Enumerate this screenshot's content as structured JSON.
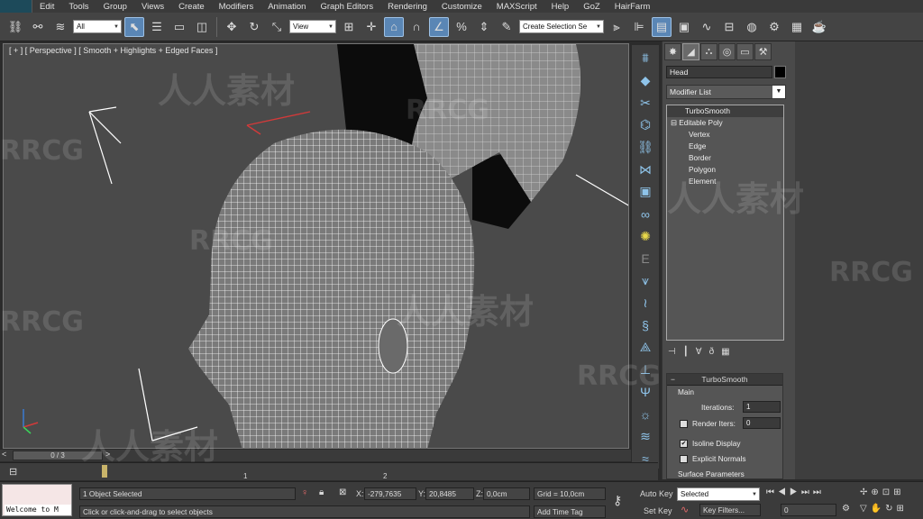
{
  "menu": [
    "Edit",
    "Tools",
    "Group",
    "Views",
    "Create",
    "Modifiers",
    "Animation",
    "Graph Editors",
    "Rendering",
    "Customize",
    "MAXScript",
    "Help",
    "GoZ",
    "HairFarm"
  ],
  "toolbar": {
    "filter_value": "All",
    "refcoord_value": "View",
    "selection_set_placeholder": "Create Selection Se"
  },
  "viewport": {
    "label": "[ + ] [ Perspective ] [ Smooth + Highlights + Edged Faces ]"
  },
  "panel": {
    "object_name": "Head",
    "object_color": "#000000",
    "modifier_list_label": "Modifier List",
    "stack": {
      "turbosmooth": "TurboSmooth",
      "editable_poly": "Editable Poly",
      "subobjects": [
        "Vertex",
        "Edge",
        "Border",
        "Polygon",
        "Element"
      ]
    },
    "turbosmooth_rollout": {
      "title": "TurboSmooth",
      "group_main": "Main",
      "iterations_label": "Iterations:",
      "iterations_value": "1",
      "render_iters_label": "Render Iters:",
      "render_iters_value": "0",
      "isoline_label": "Isoline Display",
      "isoline_checked": true,
      "explicit_normals_label": "Explicit Normals",
      "explicit_normals_checked": false,
      "surface_params_label": "Surface Parameters"
    }
  },
  "timeline": {
    "frame_range": "0 / 3",
    "ticks": [
      "1",
      "2"
    ]
  },
  "status": {
    "listener_text": "Welcome to M",
    "selection": "1 Object Selected",
    "prompt": "Click or click-and-drag to select objects",
    "x_label": "X:",
    "x_value": "-279,7635",
    "y_label": "Y:",
    "y_value": "20,8485",
    "z_label": "Z:",
    "z_value": "0,0cm",
    "grid": "Grid = 10,0cm",
    "add_time_tag": "Add Time Tag",
    "auto_key": "Auto Key",
    "set_key": "Set Key",
    "key_mode_value": "Selected",
    "key_filters": "Key Filters...",
    "current_frame": "0"
  },
  "watermarks": [
    "人人素材",
    "RRCG",
    "RRCG",
    "人人素材",
    "RRCG",
    "人人素材",
    "RRCG",
    "人人素材",
    "RRCG",
    "RRCG"
  ],
  "colors": {
    "viewport_bg": "#4a4a4a",
    "wire": "#ffffff",
    "active_blue": "#5a86b5"
  }
}
